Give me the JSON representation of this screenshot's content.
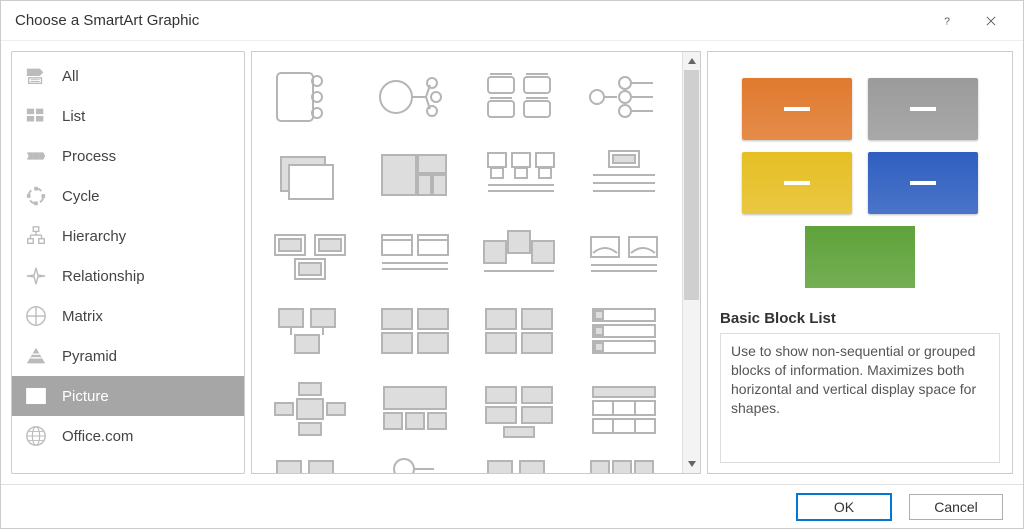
{
  "title": "Choose a SmartArt Graphic",
  "sidebar": {
    "items": [
      {
        "label": "All"
      },
      {
        "label": "List"
      },
      {
        "label": "Process"
      },
      {
        "label": "Cycle"
      },
      {
        "label": "Hierarchy"
      },
      {
        "label": "Relationship"
      },
      {
        "label": "Matrix"
      },
      {
        "label": "Pyramid"
      },
      {
        "label": "Picture"
      },
      {
        "label": "Office.com"
      }
    ]
  },
  "preview": {
    "title": "Basic Block List",
    "description": "Use to show non-sequential or grouped blocks of information. Maximizes both horizontal and vertical display space for shapes.",
    "blocks": {
      "colors": [
        "#e07a2e",
        "#9b9b9b",
        "#e6bf24",
        "#2f5fc0",
        "#5fa23a"
      ]
    }
  },
  "footer": {
    "ok": "OK",
    "cancel": "Cancel"
  }
}
